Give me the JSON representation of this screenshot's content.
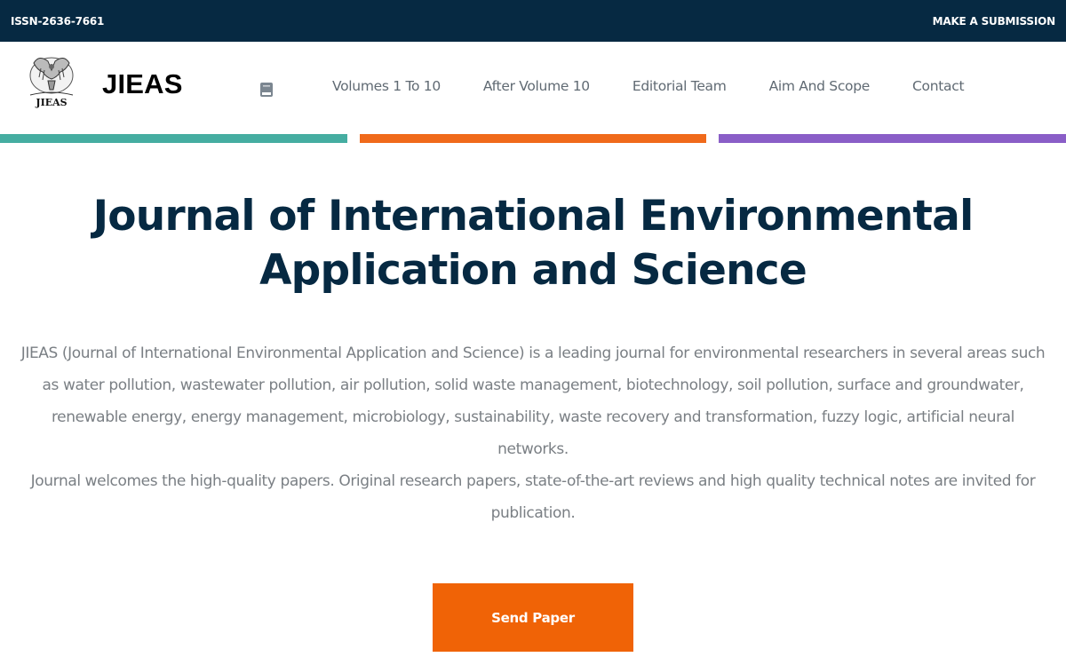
{
  "topbar": {
    "issn": "ISSN-2636-7661",
    "submission": "MAKE A SUBMISSION",
    "bg_color": "#062942"
  },
  "header": {
    "logo_text": "JIEAS",
    "brand": "JIEAS",
    "book_icon": "book-icon",
    "nav": [
      {
        "label": "Volumes 1 To 10"
      },
      {
        "label": "After Volume 10"
      },
      {
        "label": "Editorial Team"
      },
      {
        "label": "Aim And Scope"
      },
      {
        "label": "Contact"
      }
    ]
  },
  "stripes": {
    "colors": [
      "#45ada1",
      "#f06a1b",
      "#8a5ec7"
    ]
  },
  "hero": {
    "title_line1": "Journal of International Environmental",
    "title_line2": "Application and Science",
    "paragraph1": "JIEAS (Journal of International Environmental Application and Science) is a leading journal for environmental researchers in several areas such as water pollution, wastewater pollution, air pollution, solid waste management, biotechnology, soil pollution, surface and groundwater, renewable energy, energy management, microbiology, sustainability, waste recovery and transformation, fuzzy logic, artificial neural networks.",
    "paragraph2": "Journal welcomes the high-quality papers. Original research papers, state-of-the-art reviews and high quality technical notes are invited for publication.",
    "button_label": "Send Paper",
    "accent_color": "#f06306",
    "title_color": "#062942"
  }
}
